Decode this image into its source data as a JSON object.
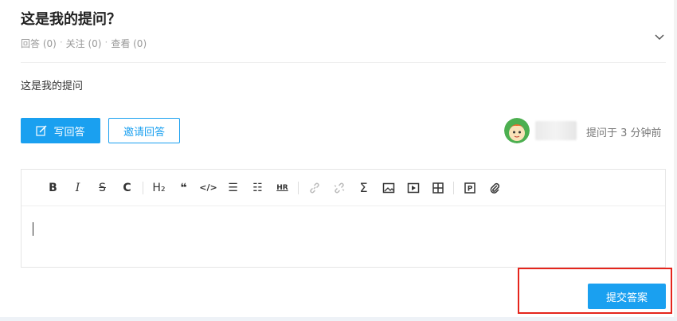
{
  "question": {
    "title": "这是我的提问？",
    "stats": {
      "answers": "回答 (0)",
      "follows": "关注 (0)",
      "views": "查看 (0)",
      "separator": "·"
    },
    "body": "这是我的提问"
  },
  "actions": {
    "write_answer": "写回答",
    "invite_answer": "邀请回答"
  },
  "author": {
    "asked_time": "提问于 3 分钟前"
  },
  "editor": {
    "toolbar": [
      {
        "name": "bold-button",
        "glyph": "B"
      },
      {
        "name": "italic-button",
        "glyph": "I"
      },
      {
        "name": "strikethrough-button",
        "glyph": "S"
      },
      {
        "name": "clear-format-button",
        "glyph": "C"
      },
      {
        "name": "heading-button",
        "glyph": "H₂"
      },
      {
        "name": "quote-button",
        "glyph": "❝"
      },
      {
        "name": "code-button",
        "glyph": "</>"
      },
      {
        "name": "bullet-list-button",
        "glyph": "☰"
      },
      {
        "name": "ordered-list-button",
        "glyph": "☷"
      },
      {
        "name": "horizontal-rule-button",
        "glyph": "HR"
      },
      {
        "name": "link-button",
        "glyph": "🔗"
      },
      {
        "name": "unlink-button",
        "glyph": "⛓"
      },
      {
        "name": "formula-button",
        "glyph": "Σ"
      },
      {
        "name": "image-button",
        "glyph": "▣"
      },
      {
        "name": "video-button",
        "glyph": "▶"
      },
      {
        "name": "table-button",
        "glyph": "⊞"
      },
      {
        "name": "page-button",
        "glyph": "P"
      },
      {
        "name": "attachment-button",
        "glyph": "📎"
      }
    ]
  },
  "submit": {
    "label": "提交答案"
  },
  "colors": {
    "accent": "#1aa0f0",
    "highlight": "#e5251c"
  }
}
